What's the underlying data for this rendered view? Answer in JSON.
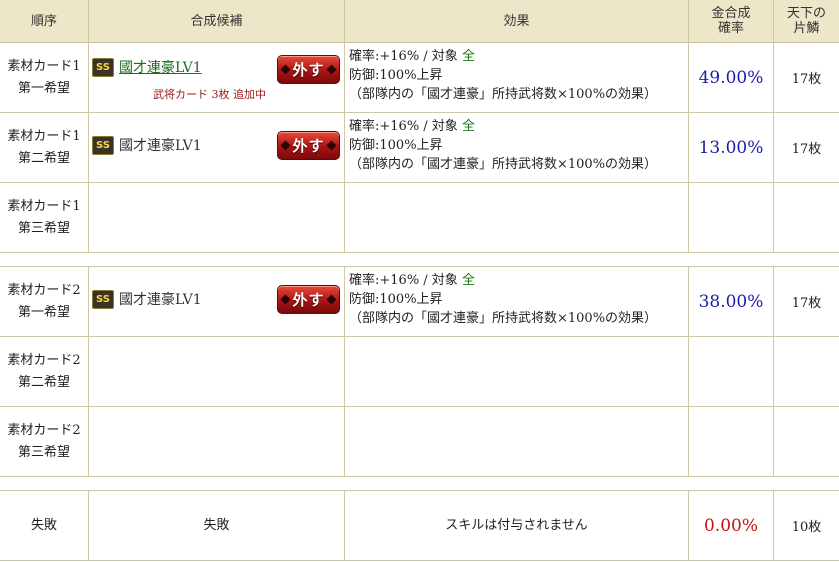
{
  "headers": {
    "order": "順序",
    "candidate": "合成候補",
    "effect": "効果",
    "gold_rate": "金合成\n確率",
    "fragments": "天下の\n片鱗"
  },
  "rows": [
    {
      "order_line1": "素材カード1",
      "order_line2": "第一希望",
      "rank": "SS",
      "skill": "國才連豪LV1",
      "skill_linked": true,
      "note": "武将カード 3枚 追加中",
      "remove_label": "外す",
      "effect_line1_prefix": "確率:+16% / 対象 ",
      "effect_target": "全",
      "effect_line2": "防御:100%上昇",
      "effect_line3": "（部隊内の「國才連豪」所持武将数×100%の効果）",
      "rate": "49.00%",
      "fragments": "17枚"
    },
    {
      "order_line1": "素材カード1",
      "order_line2": "第二希望",
      "rank": "SS",
      "skill": "國才連豪LV1",
      "skill_linked": false,
      "remove_label": "外す",
      "effect_line1_prefix": "確率:+16% / 対象 ",
      "effect_target": "全",
      "effect_line2": "防御:100%上昇",
      "effect_line3": "（部隊内の「國才連豪」所持武将数×100%の効果）",
      "rate": "13.00%",
      "fragments": "17枚"
    },
    {
      "order_line1": "素材カード1",
      "order_line2": "第三希望"
    },
    {
      "order_line1": "素材カード2",
      "order_line2": "第一希望",
      "rank": "SS",
      "skill": "國才連豪LV1",
      "skill_linked": false,
      "remove_label": "外す",
      "effect_line1_prefix": "確率:+16% / 対象 ",
      "effect_target": "全",
      "effect_line2": "防御:100%上昇",
      "effect_line3": "（部隊内の「國才連豪」所持武将数×100%の効果）",
      "rate": "38.00%",
      "fragments": "17枚"
    },
    {
      "order_line1": "素材カード2",
      "order_line2": "第二希望"
    },
    {
      "order_line1": "素材カード2",
      "order_line2": "第三希望"
    }
  ],
  "failure": {
    "order": "失敗",
    "candidate": "失敗",
    "effect": "スキルは付与されません",
    "rate": "0.00%",
    "fragments": "10枚"
  },
  "colors": {
    "header_bg": "#ede7c9",
    "rate_blue": "#1c1ca6",
    "rate_red": "#c81212",
    "link_green": "#1a6e1a",
    "note_red": "#9a1818"
  }
}
